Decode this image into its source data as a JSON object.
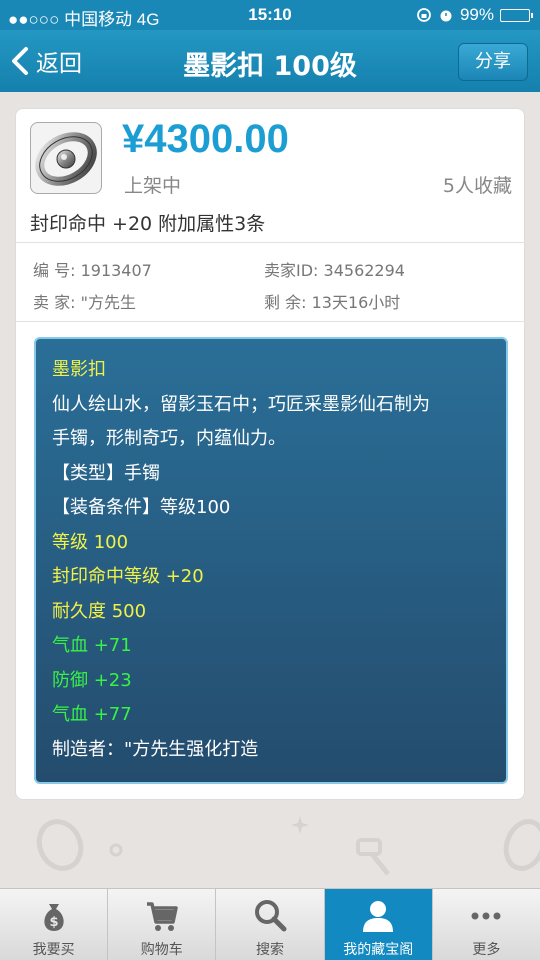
{
  "status_bar": {
    "carrier": "●●○○○ 中国移动  4G",
    "time": "15:10",
    "battery": "99%",
    "battery_level": 0.99
  },
  "nav": {
    "back_label": "返回",
    "title": "墨影扣 100级",
    "share_label": "分享"
  },
  "item": {
    "price": "¥4300.00",
    "status": "上架中",
    "favorites": "5人收藏",
    "summary": "封印命中 +20  附加属性3条",
    "meta": {
      "id_label": "编  号:",
      "id_value": "1913407",
      "seller_id_label": "卖家ID:",
      "seller_id_value": "34562294",
      "seller_label": "卖  家:",
      "seller_value": "\"方先生",
      "remain_label": "剩  余:",
      "remain_value": "13天16小时"
    }
  },
  "description": {
    "name": "墨影扣",
    "lore_1": "仙人绘山水，留影玉石中；巧匠采墨影仙石制为",
    "lore_2": "手镯，形制奇巧，内蕴仙力。",
    "type": "【类型】手镯",
    "requirement": "【装备条件】等级100",
    "level": "等级 100",
    "seal_hit": "封印命中等级 +20",
    "durability": "耐久度 500",
    "hp_1": "气血 +71",
    "defense": "防御 +23",
    "hp_2": "气血 +77",
    "maker": "制造者：\"方先生强化打造"
  },
  "tabbar": {
    "tabs": [
      {
        "label": "我要买",
        "icon": "money-bag-icon"
      },
      {
        "label": "购物车",
        "icon": "cart-icon"
      },
      {
        "label": "搜索",
        "icon": "search-icon"
      },
      {
        "label": "我的藏宝阁",
        "icon": "user-icon",
        "active": true
      },
      {
        "label": "更多",
        "icon": "more-icon"
      }
    ]
  },
  "colors": {
    "nav_blue": "#1a88b6",
    "price_blue": "#1c9ed2",
    "desc_bg": "#2a6f98",
    "text_yellow": "#f2f246",
    "text_green": "#38f246",
    "tab_active": "#1289c0"
  }
}
